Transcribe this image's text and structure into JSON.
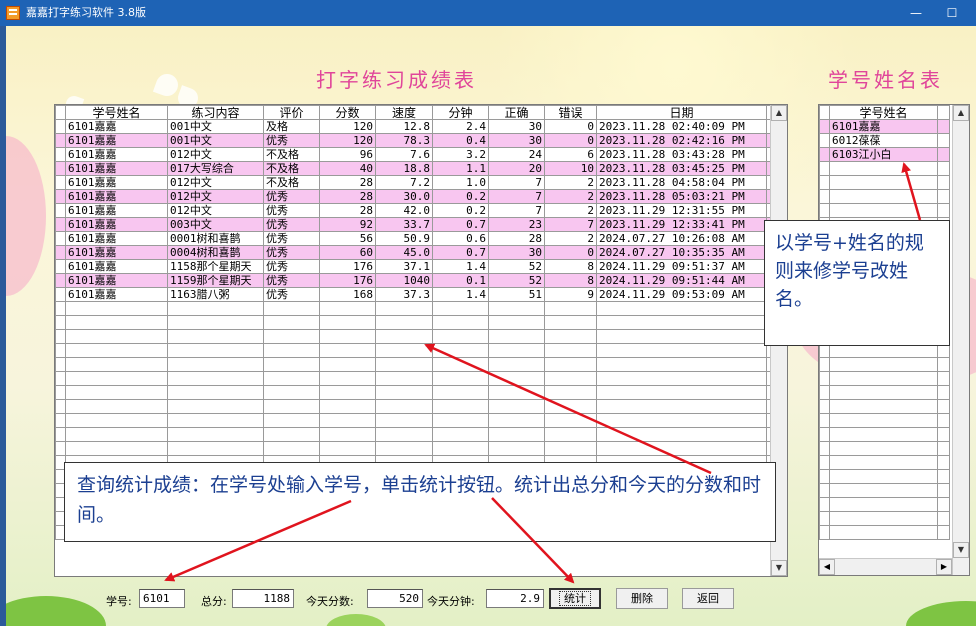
{
  "window": {
    "title": "嘉嘉打字练习软件  3.8版",
    "minimize_glyph": "—",
    "maximize_glyph": "☐"
  },
  "headings": {
    "scores_title": "打字练习成绩表",
    "names_title": "学号姓名表"
  },
  "scores": {
    "columns": [
      "学号姓名",
      "练习内容",
      "评价",
      "分数",
      "速度",
      "分钟",
      "正确",
      "错误",
      "日期"
    ],
    "rows": [
      [
        "6101嘉嘉",
        "001中文",
        "及格",
        "120",
        "12.8",
        "2.4",
        "30",
        "0",
        "2023.11.28 02:40:09 PM"
      ],
      [
        "6101嘉嘉",
        "001中文",
        "优秀",
        "120",
        "78.3",
        "0.4",
        "30",
        "0",
        "2023.11.28 02:42:16 PM"
      ],
      [
        "6101嘉嘉",
        "012中文",
        "不及格",
        "96",
        "7.6",
        "3.2",
        "24",
        "6",
        "2023.11.28 03:43:28 PM"
      ],
      [
        "6101嘉嘉",
        "017大写综合",
        "不及格",
        "40",
        "18.8",
        "1.1",
        "20",
        "10",
        "2023.11.28 03:45:25 PM"
      ],
      [
        "6101嘉嘉",
        "012中文",
        "不及格",
        "28",
        "7.2",
        "1.0",
        "7",
        "2",
        "2023.11.28 04:58:04 PM"
      ],
      [
        "6101嘉嘉",
        "012中文",
        "优秀",
        "28",
        "30.0",
        "0.2",
        "7",
        "2",
        "2023.11.28 05:03:21 PM"
      ],
      [
        "6101嘉嘉",
        "012中文",
        "优秀",
        "28",
        "42.0",
        "0.2",
        "7",
        "2",
        "2023.11.29 12:31:55 PM"
      ],
      [
        "6101嘉嘉",
        "003中文",
        "优秀",
        "92",
        "33.7",
        "0.7",
        "23",
        "7",
        "2023.11.29 12:33:41 PM"
      ],
      [
        "6101嘉嘉",
        "0001树和喜鹊",
        "优秀",
        "56",
        "50.9",
        "0.6",
        "28",
        "2",
        "2024.07.27 10:26:08 AM"
      ],
      [
        "6101嘉嘉",
        "0004树和喜鹊",
        "优秀",
        "60",
        "45.0",
        "0.7",
        "30",
        "0",
        "2024.07.27 10:35:35 AM"
      ],
      [
        "6101嘉嘉",
        "1158那个星期天",
        "优秀",
        "176",
        "37.1",
        "1.4",
        "52",
        "8",
        "2024.11.29 09:51:37 AM"
      ],
      [
        "6101嘉嘉",
        "1159那个星期天",
        "优秀",
        "176",
        "1040",
        "0.1",
        "52",
        "8",
        "2024.11.29 09:51:44 AM"
      ],
      [
        "6101嘉嘉",
        "1163腊八粥",
        "优秀",
        "168",
        "37.3",
        "1.4",
        "51",
        "9",
        "2024.11.29 09:53:09 AM"
      ]
    ]
  },
  "names": {
    "column": "学号姓名",
    "rows": [
      "6101嘉嘉",
      "6012葆葆",
      "6103江小白"
    ]
  },
  "callouts": {
    "rename_tip": "以学号+姓名的规则来修学号改姓名。",
    "query_tip": "查询统计成绩：在学号处输入学号，单击统计按钮。统计出总分和今天的分数和时间。"
  },
  "bottom": {
    "student_id_label": "学号:",
    "student_id_value": "6101",
    "total_label": "总分:",
    "total_value": "1188",
    "today_score_label": "今天分数:",
    "today_score_value": "520",
    "today_minutes_label": "今天分钟:",
    "today_minutes_value": "2.9",
    "stats_button": "统计",
    "delete_button": "删除",
    "back_button": "返回"
  },
  "colors": {
    "heading": "#e0459a",
    "highlight_row": "#f8c6f0",
    "callout_text": "#1b3f91",
    "arrow": "#e0141e"
  }
}
